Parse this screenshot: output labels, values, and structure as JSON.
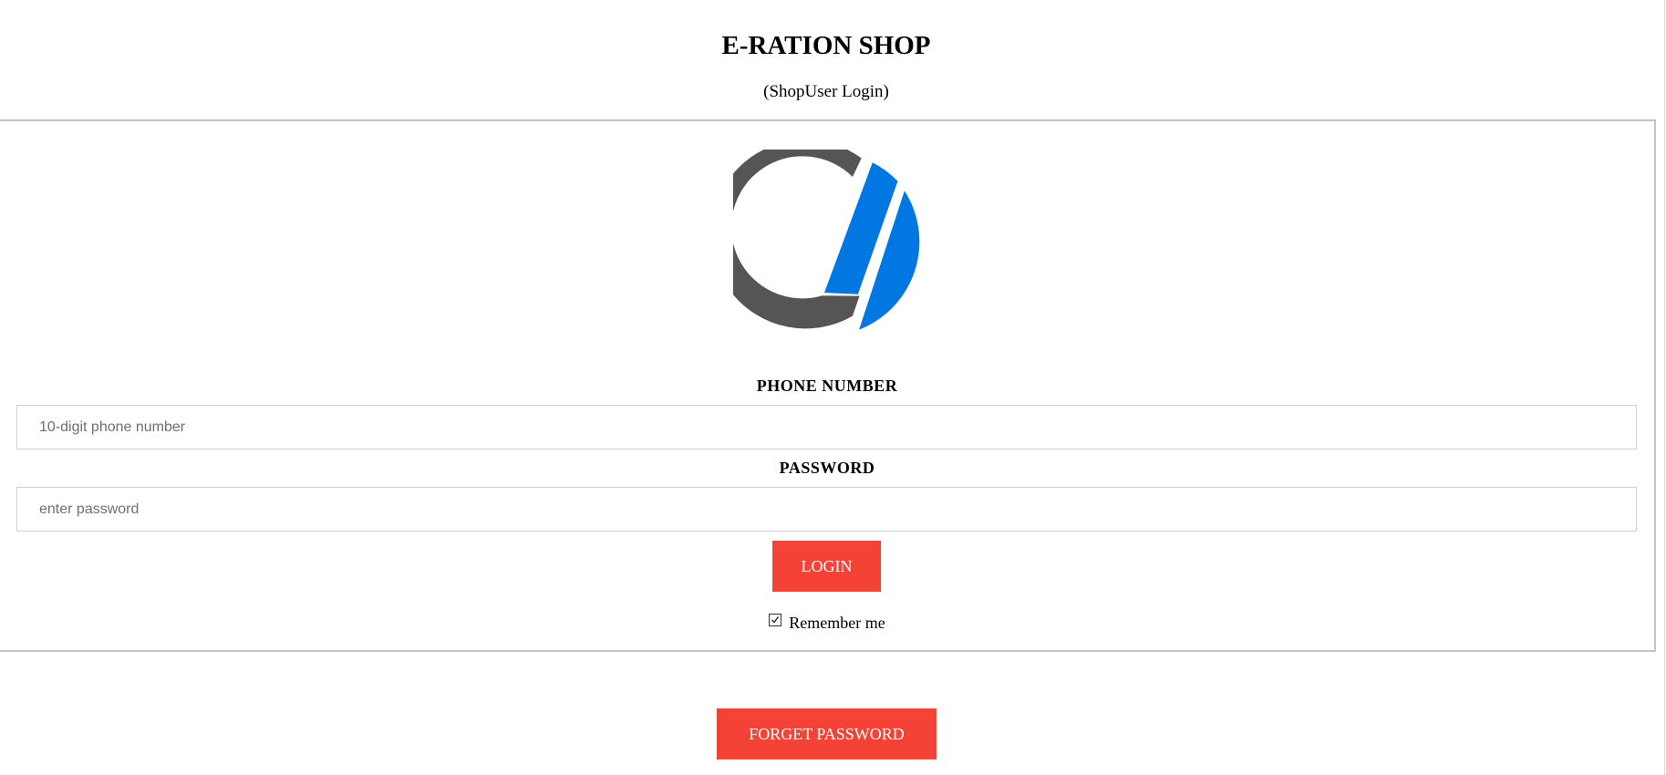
{
  "header": {
    "title": "E-RATION SHOP",
    "subtitle": "(ShopUser Login)"
  },
  "logo": {
    "icon": "brand-logo-icon",
    "colors": {
      "ring": "#555555",
      "accent": "#0077e1"
    }
  },
  "form": {
    "phone_label": "PHONE NUMBER",
    "phone_placeholder": "10-digit phone number",
    "phone_value": "",
    "password_label": "PASSWORD",
    "password_placeholder": "enter password",
    "password_value": "",
    "login_label": "LOGIN",
    "remember_label": "Remember me",
    "remember_checked": true
  },
  "footer": {
    "forgot_label": "FORGET PASSWORD"
  },
  "colors": {
    "button": "#f44336",
    "button_text": "#ffffff",
    "border": "#c4c4c4"
  }
}
